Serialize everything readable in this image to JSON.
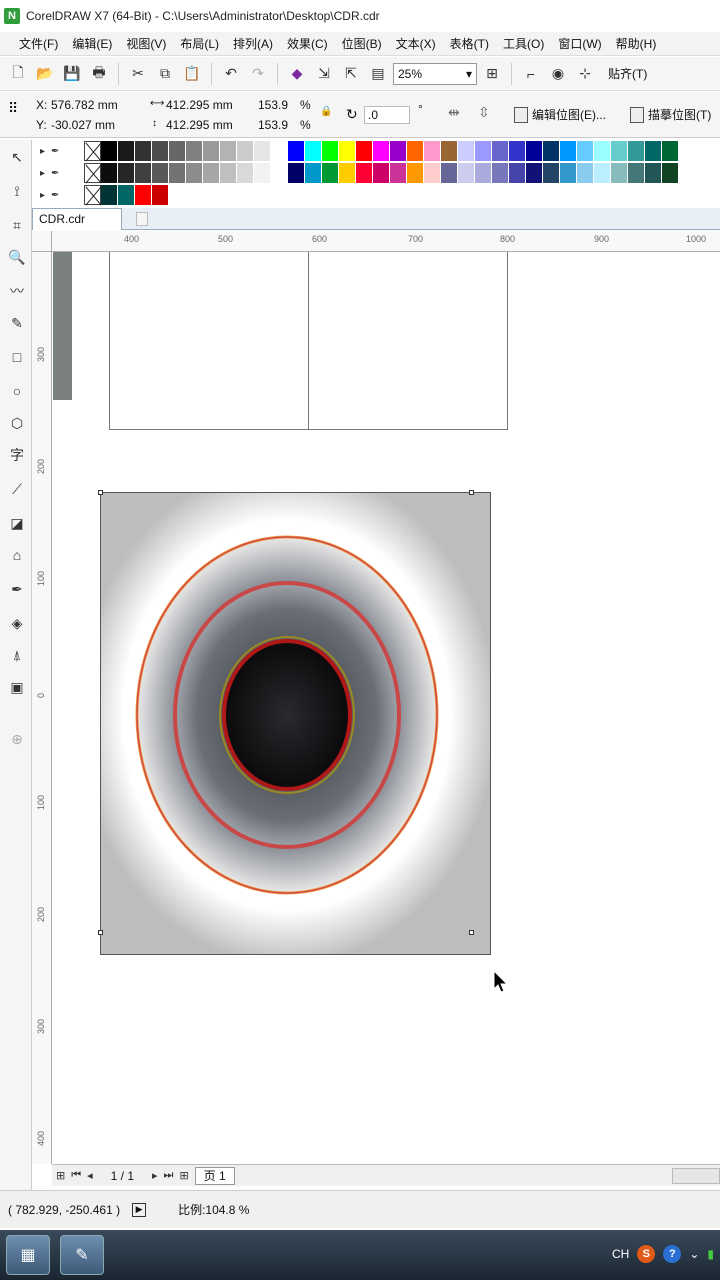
{
  "window": {
    "title": "CorelDRAW X7 (64-Bit) - C:\\Users\\Administrator\\Desktop\\CDR.cdr"
  },
  "menu": [
    "文件(F)",
    "编辑(E)",
    "视图(V)",
    "布局(L)",
    "排列(A)",
    "效果(C)",
    "位图(B)",
    "文本(X)",
    "表格(T)",
    "工具(O)",
    "窗口(W)",
    "帮助(H)"
  ],
  "toolbar": {
    "zoom": "25%",
    "snap_label": "贴齐(T)"
  },
  "props": {
    "x_label": "X:",
    "x_value": "576.782 mm",
    "y_label": "Y:",
    "y_value": "-30.027 mm",
    "width": "412.295 mm",
    "height": "412.295 mm",
    "scale_x": "153.9",
    "scale_y": "153.9",
    "percent": "%",
    "rotation": ".0",
    "degree": "°",
    "edit_bitmap": "编辑位图(E)...",
    "trace_bitmap": "描摹位图(T)"
  },
  "palette": {
    "row1": [
      "#000000",
      "#1a1a1a",
      "#333333",
      "#4d4d4d",
      "#666666",
      "#808080",
      "#999999",
      "#b3b3b3",
      "#cccccc",
      "#e6e6e6",
      "#ffffff",
      "#0000ff",
      "#00ffff",
      "#00ff00",
      "#ffff00",
      "#ff0000",
      "#ff00ff",
      "#9900cc",
      "#ff6600",
      "#ff99cc",
      "#996633",
      "#ccccff",
      "#9999ff",
      "#6666cc",
      "#3333cc",
      "#000099",
      "#003366",
      "#0099ff",
      "#66ccff",
      "#99ffff",
      "#66cccc",
      "#339999",
      "#006666",
      "#006633"
    ],
    "row2": [
      "#0d0d0d",
      "#262626",
      "#404040",
      "#595959",
      "#737373",
      "#8c8c8c",
      "#a6a6a6",
      "#bfbfbf",
      "#d9d9d9",
      "#f2f2f2",
      "#ffffff",
      "#000066",
      "#0099cc",
      "#009933",
      "#ffcc00",
      "#ff0033",
      "#cc0066",
      "#cc3399",
      "#ff9900",
      "#ffcccc",
      "#666699",
      "#ccccee",
      "#aaaadd",
      "#7777bb",
      "#4444aa",
      "#111177",
      "#224466",
      "#3399cc",
      "#88ccee",
      "#bbeeff",
      "#88bbbb",
      "#447777",
      "#225555",
      "#114422"
    ],
    "row3": [
      "#003333",
      "#006666",
      "#ff0000",
      "#cc0000",
      "#ffffff",
      "#ffffff"
    ]
  },
  "document": {
    "tab": "CDR.cdr"
  },
  "ruler": {
    "h": [
      "400",
      "500",
      "600",
      "700",
      "800",
      "900",
      "1000"
    ],
    "v": [
      "300",
      "200",
      "100",
      "0",
      "100",
      "200",
      "300",
      "400"
    ]
  },
  "pager": {
    "page_count": "1 / 1",
    "page_tab": "页 1"
  },
  "status": {
    "coords": "( 782.929, -250.461 )",
    "scale": "比例:104.8 %"
  },
  "taskbar": {
    "tray_lang": "CH"
  }
}
